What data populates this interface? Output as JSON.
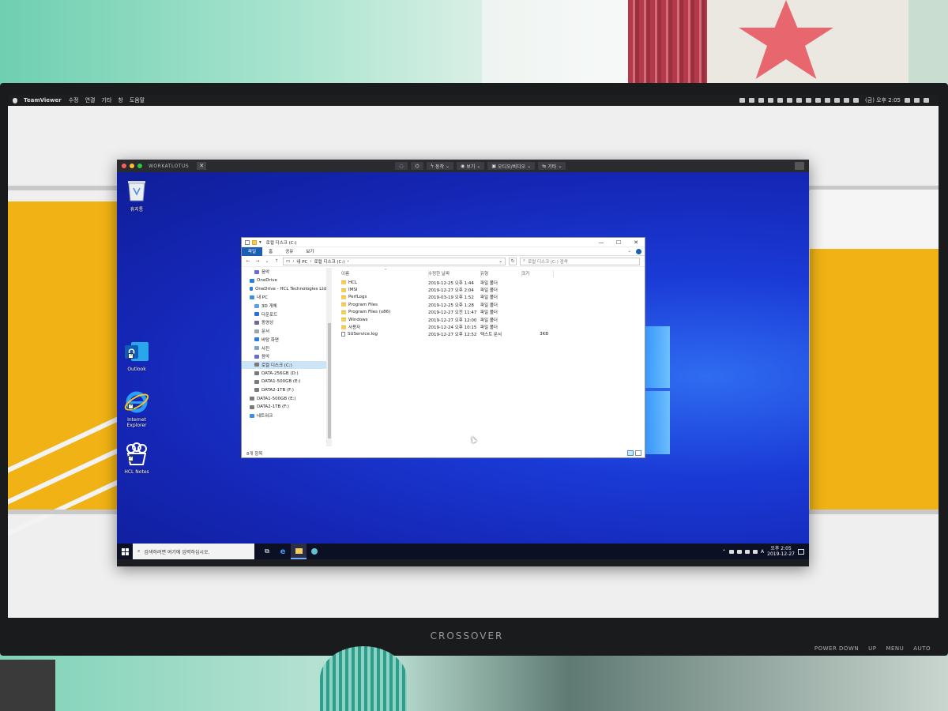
{
  "mac_menubar": {
    "app": "TeamViewer",
    "menus": [
      "수정",
      "연결",
      "기타",
      "창",
      "도움말"
    ],
    "clock": "(금) 오후 2:05"
  },
  "teamviewer": {
    "window_title": "WORKATLOTUS",
    "toolbar": {
      "actions": "동작",
      "view": "보기",
      "audio_video": "오디오/비디오",
      "extras": "기타"
    }
  },
  "desktop_icons": {
    "recycle_bin": "휴지통",
    "outlook": "Outlook",
    "internet_explorer": "Internet Explorer",
    "hcl_notes": "HCL Notes"
  },
  "explorer": {
    "title": "로컬 디스크 (C:)",
    "ribbon_tabs": [
      "파일",
      "홈",
      "공유",
      "보기"
    ],
    "address": {
      "root": "내 PC",
      "current": "로컬 디스크 (C:)"
    },
    "search_placeholder": "로컬 디스크 (C:) 검색",
    "nav_items": [
      {
        "label": "음악",
        "icon": "music-icon",
        "indent": 1
      },
      {
        "label": "OneDrive",
        "icon": "cloud-icon",
        "indent": 0
      },
      {
        "label": "OneDrive - HCL Technologies Ltd",
        "icon": "cloud-icon",
        "indent": 0
      },
      {
        "label": "내 PC",
        "icon": "pc-icon",
        "indent": 0
      },
      {
        "label": "3D 개체",
        "icon": "3d-objects-icon",
        "indent": 1
      },
      {
        "label": "다운로드",
        "icon": "download-icon",
        "indent": 1
      },
      {
        "label": "동영상",
        "icon": "video-icon",
        "indent": 1
      },
      {
        "label": "문서",
        "icon": "document-icon",
        "indent": 1
      },
      {
        "label": "바탕 화면",
        "icon": "desktop-icon",
        "indent": 1
      },
      {
        "label": "사진",
        "icon": "picture-icon",
        "indent": 1
      },
      {
        "label": "음악",
        "icon": "music-icon",
        "indent": 1
      },
      {
        "label": "로컬 디스크 (C:)",
        "icon": "drive-icon",
        "indent": 1,
        "selected": true
      },
      {
        "label": "DATA-256GB (D:)",
        "icon": "drive-icon",
        "indent": 1
      },
      {
        "label": "DATA1-500GB (E:)",
        "icon": "drive-icon",
        "indent": 1
      },
      {
        "label": "DATA2-1TB (F:)",
        "icon": "drive-icon",
        "indent": 1
      },
      {
        "label": "DATA1-500GB (E:)",
        "icon": "drive-icon",
        "indent": 0
      },
      {
        "label": "DATA2-1TB (F:)",
        "icon": "drive-icon",
        "indent": 0
      },
      {
        "label": "네트워크",
        "icon": "network-icon",
        "indent": 0
      }
    ],
    "columns": {
      "name": "이름",
      "date": "수정한 날짜",
      "type": "유형",
      "size": "크기"
    },
    "files": [
      {
        "name": "HCL",
        "date": "2019-12-25 오후 1:44",
        "type": "파일 폴더",
        "size": "",
        "kind": "folder"
      },
      {
        "name": "IMSI",
        "date": "2019-12-27 오후 2:04",
        "type": "파일 폴더",
        "size": "",
        "kind": "folder"
      },
      {
        "name": "PerfLogs",
        "date": "2019-03-19 오후 1:52",
        "type": "파일 폴더",
        "size": "",
        "kind": "folder"
      },
      {
        "name": "Program Files",
        "date": "2019-12-25 오후 1:28",
        "type": "파일 폴더",
        "size": "",
        "kind": "folder"
      },
      {
        "name": "Program Files (x86)",
        "date": "2019-12-27 오전 11:47",
        "type": "파일 폴더",
        "size": "",
        "kind": "folder"
      },
      {
        "name": "Windows",
        "date": "2019-12-27 오후 12:00",
        "type": "파일 폴더",
        "size": "",
        "kind": "folder"
      },
      {
        "name": "사용자",
        "date": "2019-12-24 오후 10:15",
        "type": "파일 폴더",
        "size": "",
        "kind": "folder"
      },
      {
        "name": "SUService.log",
        "date": "2019-12-27 오후 12:52",
        "type": "텍스트 문서",
        "size": "3KB",
        "kind": "file"
      }
    ],
    "status": "8개 항목"
  },
  "taskbar": {
    "search_placeholder": "검색하려면 여기에 입력하십시오.",
    "ime": "A",
    "time": "오후 2:05",
    "date": "2019-12-27"
  },
  "monitor": {
    "brand": "CROSSOVER",
    "buttons": [
      "POWER DOWN",
      "UP",
      "MENU",
      "AUTO"
    ]
  },
  "colors": {
    "ribbon_file_tab": "#1b5fb5",
    "selection": "#cce4f7",
    "folder": "#f3cd5d",
    "desktop_blue": "#1526b5"
  }
}
